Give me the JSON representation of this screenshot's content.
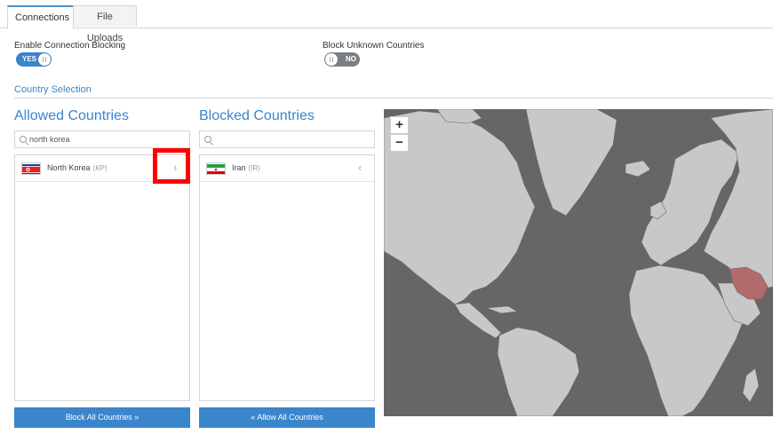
{
  "tabs": [
    {
      "label": "Connections",
      "active": true
    },
    {
      "label": "File Uploads",
      "active": false
    }
  ],
  "settings": {
    "enable_connection_blocking": {
      "label": "Enable Connection Blocking",
      "value_text": "YES",
      "on": true
    },
    "block_unknown_countries": {
      "label": "Block Unknown Countries",
      "value_text": "NO",
      "on": false
    }
  },
  "section_title": "Country Selection",
  "allowed": {
    "title": "Allowed Countries",
    "search_value": "north korea",
    "countries": [
      {
        "name": "North Korea",
        "code": "(KP)",
        "action_icon": "chevron-right-icon"
      }
    ],
    "button_label": "Block All Countries »"
  },
  "blocked": {
    "title": "Blocked Countries",
    "search_value": "",
    "countries": [
      {
        "name": "Iran",
        "code": "(IR)",
        "action_icon": "chevron-left-icon"
      }
    ],
    "button_label": "« Allow All Countries"
  },
  "map": {
    "zoom_in": "+",
    "zoom_out": "−",
    "highlighted_country": "Iran",
    "colors": {
      "water": "#666666",
      "land": "#c8c8c8",
      "blocked": "#b36b6b"
    }
  },
  "colors": {
    "accent": "#3a85cc",
    "highlight_box": "#ff0000"
  }
}
